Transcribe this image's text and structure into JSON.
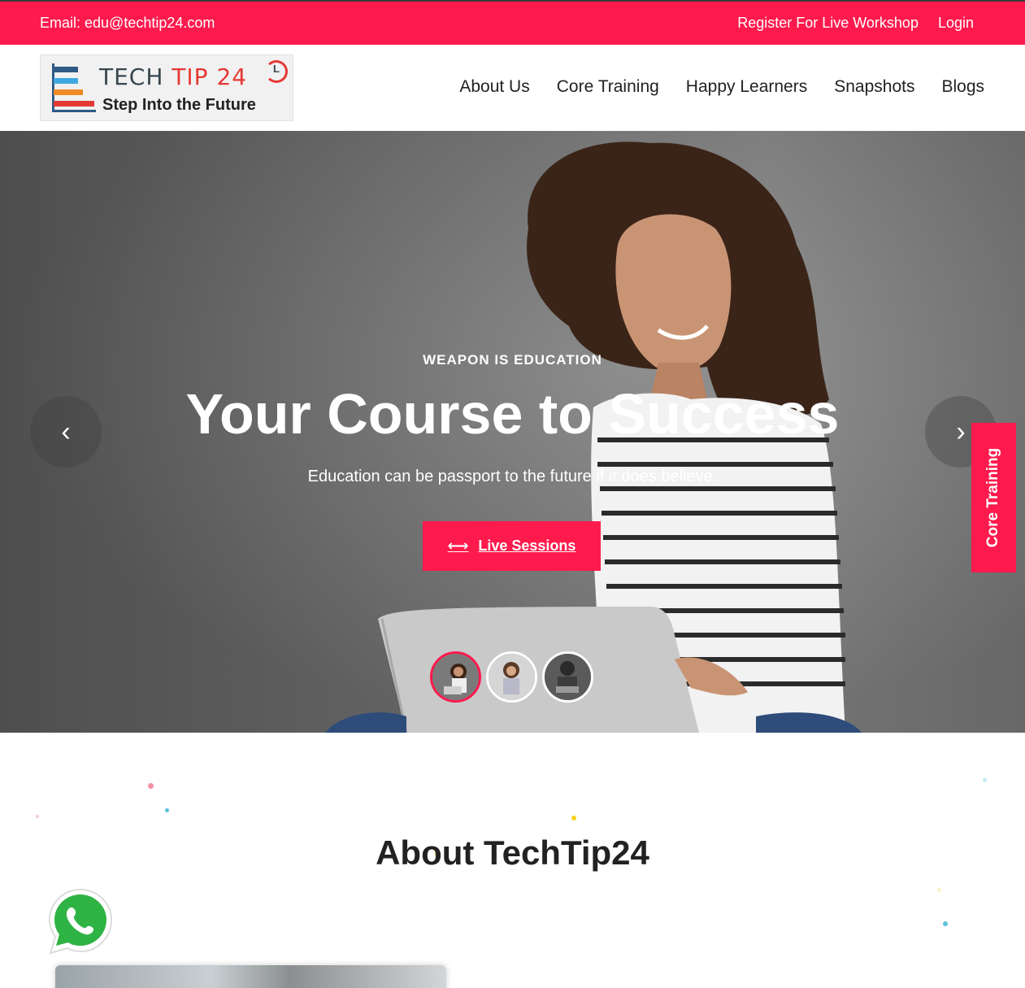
{
  "topbar": {
    "email": "Email: edu@techtip24.com",
    "register_link": "Register For Live Workshop",
    "login_link": "Login"
  },
  "logo": {
    "title_part1": "TECH ",
    "title_part2": "TIP 24",
    "clock_letter": "L",
    "tagline": "Step Into the Future"
  },
  "nav": {
    "items": [
      "About Us",
      "Core Training",
      "Happy Learners",
      "Snapshots",
      "Blogs"
    ]
  },
  "hero": {
    "eyebrow": "WEAPON IS EDUCATION",
    "headline": "Your Course to Success",
    "subline": "Education can be passport to the future if it does believe.",
    "cta_label": "Live Sessions",
    "cta_icon": "left-right-arrow-icon",
    "prev_icon": "chevron-left-icon",
    "next_icon": "chevron-right-icon",
    "active_slide": 1,
    "slide_count": 3
  },
  "side_tab": {
    "label": "Core Training"
  },
  "about": {
    "title": "About TechTip24"
  },
  "colors": {
    "accent": "#fe1a4d",
    "text_dark": "#222222"
  }
}
